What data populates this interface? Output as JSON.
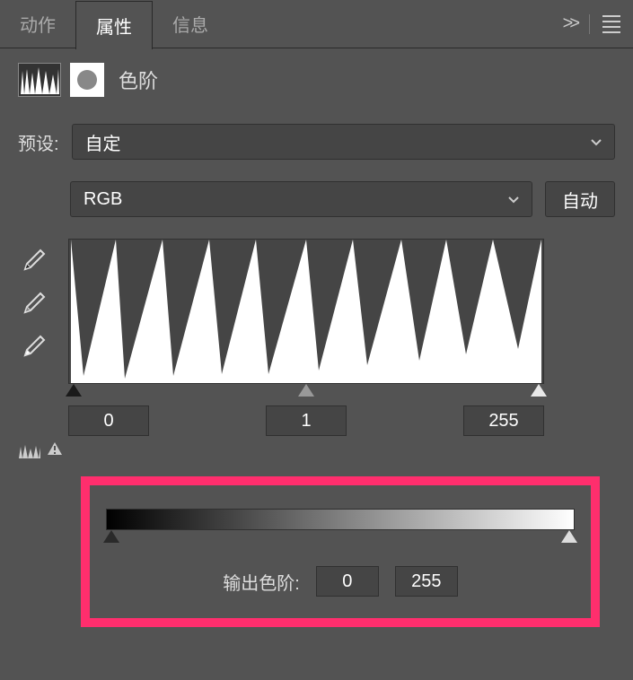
{
  "tabs": {
    "actions": "动作",
    "properties": "属性",
    "info": "信息"
  },
  "adjustment": {
    "title": "色阶"
  },
  "preset": {
    "label": "预设:",
    "value": "自定"
  },
  "channel": {
    "value": "RGB",
    "auto_button": "自动"
  },
  "input_levels": {
    "black": "0",
    "gamma": "1",
    "white": "255"
  },
  "output": {
    "label": "输出色阶:",
    "black": "0",
    "white": "255"
  },
  "chart_data": {
    "type": "area",
    "title": "",
    "xlabel": "",
    "ylabel": "",
    "xlim": [
      0,
      255
    ],
    "ylim": [
      0,
      1
    ],
    "series": [
      {
        "name": "histogram",
        "x": [
          0,
          12,
          25,
          38,
          51,
          64,
          76,
          89,
          102,
          115,
          128,
          140,
          153,
          166,
          179,
          191,
          204,
          217,
          230,
          242,
          255
        ],
        "y_peak": [
          1,
          0.05,
          1,
          0.05,
          1,
          0.05,
          1,
          0.05,
          1,
          0.08,
          1,
          0.1,
          1,
          0.15,
          1,
          0.2,
          1,
          0.25,
          1,
          0.3,
          1
        ]
      }
    ]
  }
}
